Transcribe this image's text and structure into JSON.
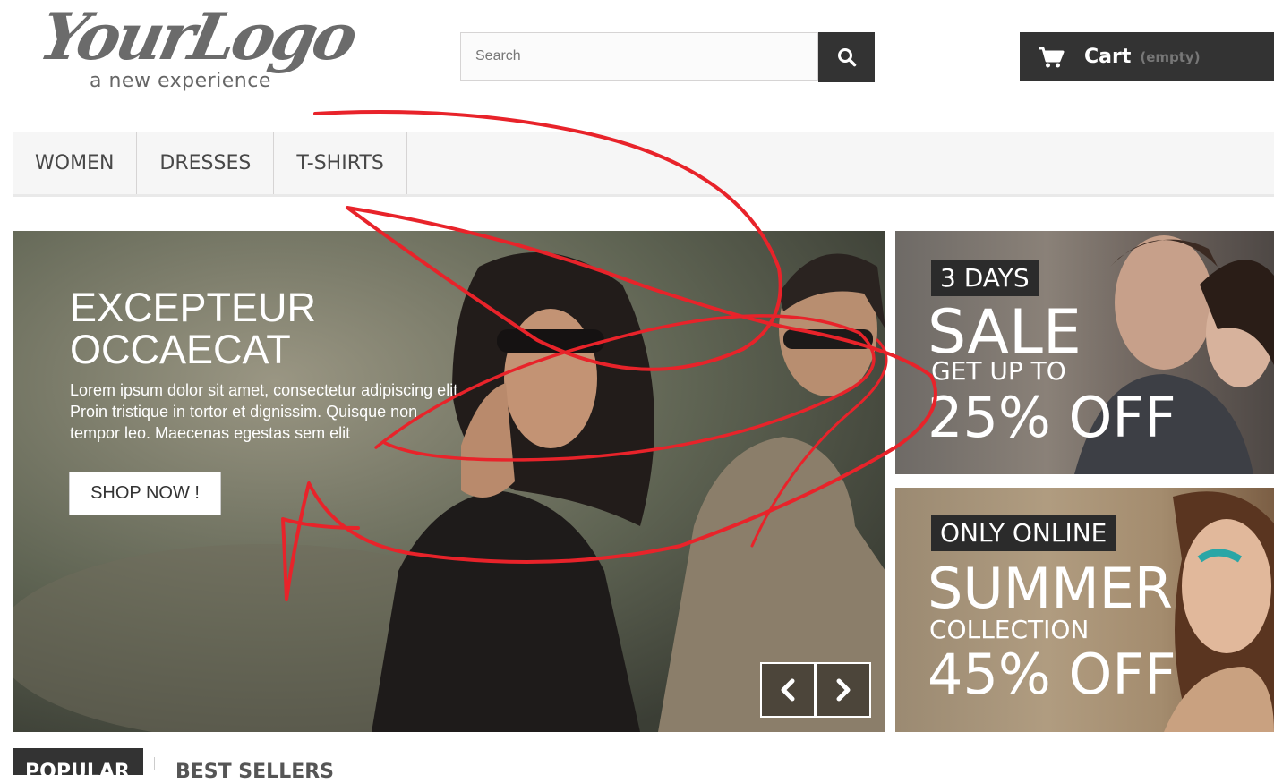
{
  "header": {
    "logo_script": "YourLogo",
    "logo_tagline": "a new experience",
    "search_placeholder": "Search",
    "search_icon": "search-icon",
    "cart_label": "Cart",
    "cart_quantity": "(empty)",
    "cart_icon": "cart-icon"
  },
  "menu": {
    "items": [
      {
        "label": "WOMEN"
      },
      {
        "label": "DRESSES"
      },
      {
        "label": "T-SHIRTS"
      }
    ]
  },
  "slider": {
    "title_line1": "EXCEPTEUR",
    "title_line2": "OCCAECAT",
    "text": "Lorem ipsum dolor sit amet, consectetur adipiscing elit. Proin tristique in tortor et dignissim. Quisque non tempor leo. Maecenas egestas sem elit",
    "button": "SHOP NOW !",
    "prev_icon": "chevron-left-icon",
    "next_icon": "chevron-right-icon"
  },
  "banners": [
    {
      "tag": "3 DAYS",
      "line1": "SALE",
      "line2": "GET UP TO",
      "line3": "25% OFF"
    },
    {
      "tag": "ONLY ONLINE",
      "line1": "SUMMER",
      "line2": "COLLECTION",
      "line3": "45% OFF"
    }
  ],
  "tabs": [
    {
      "label": "POPULAR"
    },
    {
      "label": "BEST SELLERS"
    }
  ],
  "colors": {
    "dark": "#333333",
    "menu_bg": "#f6f6f6",
    "annotation": "#e8232a"
  }
}
